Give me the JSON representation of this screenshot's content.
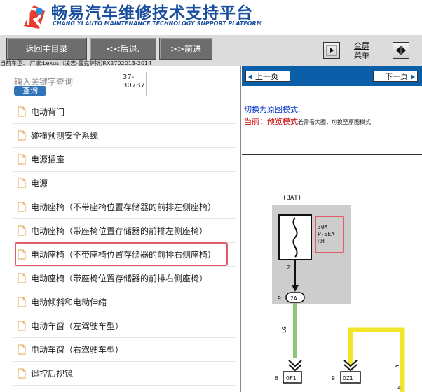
{
  "header": {
    "title": "畅易汽车维修技术支持平台",
    "subtitle": "CHANG YI AUTO MAINTENANCE TECHNOLOGY SUPPORT PLATFORM",
    "brand_color": "#1a4fa0"
  },
  "toolbar": {
    "home_label": "返回主目录",
    "back_label": "<<后退.",
    "forward_label": ">>前进",
    "fullscreen_line1": "全屏",
    "fullscreen_line2": "菜单"
  },
  "vehicle_info": "当前车型： 厂家:Lexus（凌志-雷克萨斯)RX2702013-2014",
  "search": {
    "hint": "输入关键字查询",
    "button_label": "查询",
    "code_line1": "37-",
    "code_line2": "30787"
  },
  "items": [
    {
      "label": "电动背门"
    },
    {
      "label": "碰撞预测安全系统"
    },
    {
      "label": "电源插座"
    },
    {
      "label": "电源"
    },
    {
      "label": "电动座椅（不带座椅位置存储器的前排左侧座椅）"
    },
    {
      "label": "电动座椅（带座椅位置存储器的前排左侧座椅）"
    },
    {
      "label": "电动座椅（不带座椅位置存储器的前排右侧座椅）",
      "selected": true
    },
    {
      "label": "电动座椅（带座椅位置存储器的前排右侧座椅）"
    },
    {
      "label": "电动倾斜和电动伸缩"
    },
    {
      "label": "电动车窗（左驾驶车型）"
    },
    {
      "label": "电动车窗（右驾驶车型）"
    },
    {
      "label": "遥控后视镜"
    }
  ],
  "viewer": {
    "prev_label": "上一页",
    "next_label": "下一页",
    "switch_link": "切换为原图模式.",
    "current_label": "当前：",
    "current_mode": "预览模式",
    "hint": "若需看大图，切换至原图模式",
    "accent_red": "#cc0000",
    "pager_color": "#0b5ea8"
  },
  "diagram": {
    "bat_label": "(BAT)",
    "fuse_line1": "30A",
    "fuse_line2": "P-SEAT",
    "fuse_line3": "RH",
    "pin_2": "2",
    "pin_9": "9",
    "conn_2a": "2A",
    "wire_lg": "LG",
    "wire_y": "Y",
    "pin_6": "6",
    "conn_of1": "OF1",
    "pin_9b": "9",
    "conn_oz1": "OZ1",
    "pin_4": "4",
    "watermark": "car"
  }
}
